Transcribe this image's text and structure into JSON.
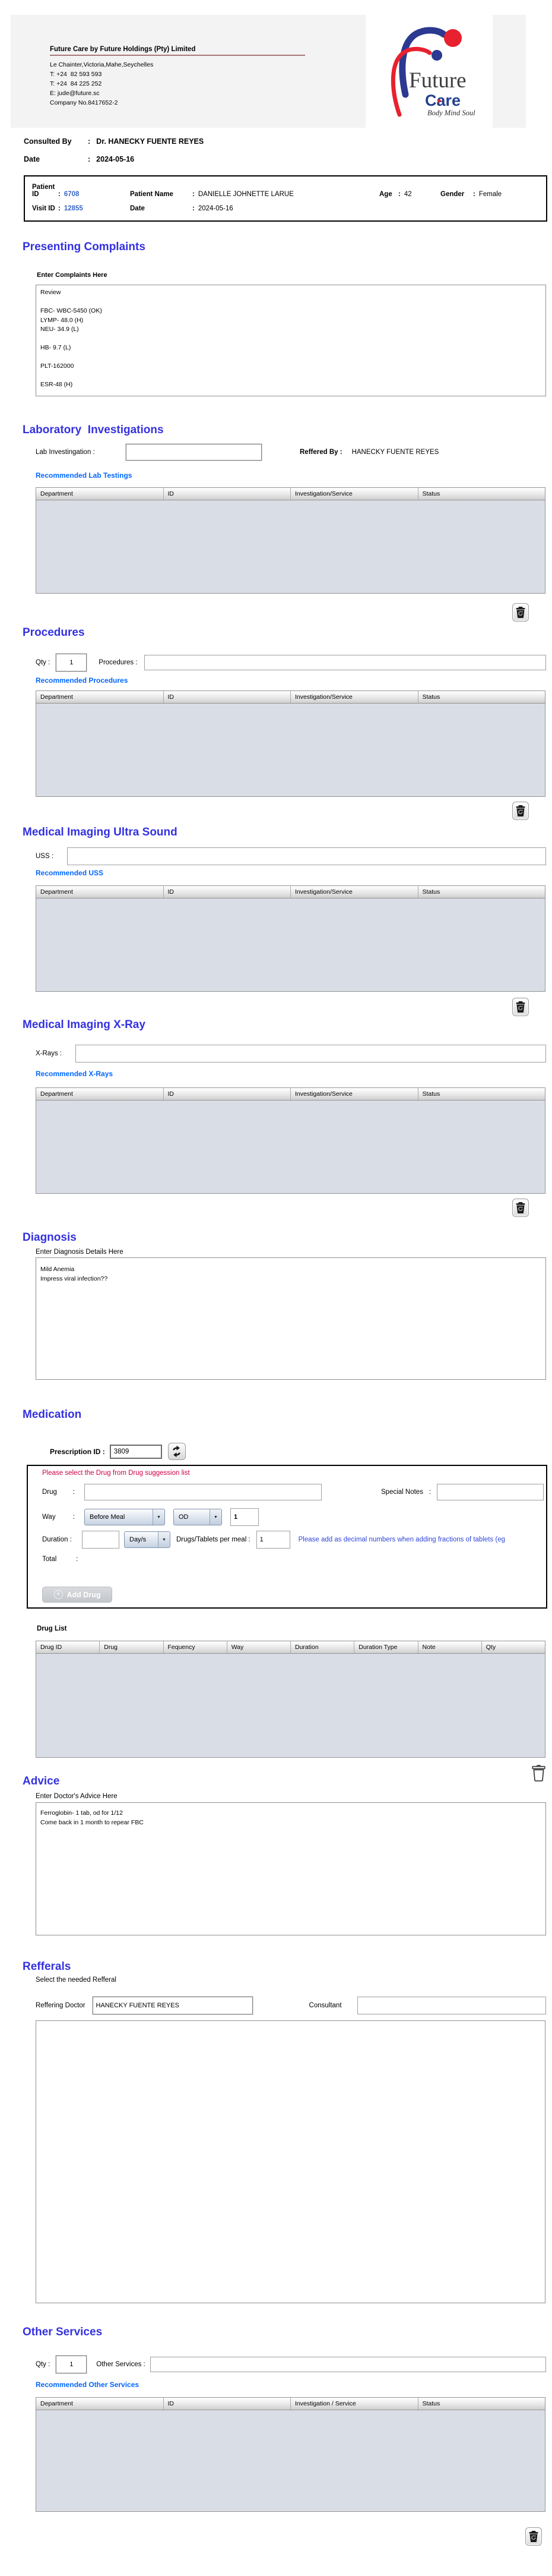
{
  "punct": {
    "colon": ":"
  },
  "colors": {
    "heading_blue": "#3431e0",
    "link_blue": "#0066ff",
    "value_blue": "#3a66c4",
    "warning_red": "#cc0044",
    "note_blue": "#2f46d8",
    "table_body": "#d9dde6"
  },
  "header": {
    "company_name": "Future Care by Future Holdings (Pty) Limited",
    "address": "Le Chainter,Victoria,Mahe,Seychelles",
    "phone1": "T: +24  82 593 593",
    "phone2": "T: +24  84 225 252",
    "email": "E: jude@future.sc",
    "company_no": "Company No.8417652-2",
    "logo": {
      "word1": "Future",
      "word2": "Care",
      "tagline": "Body Mind Soul"
    }
  },
  "consult": {
    "label": "Consulted By",
    "value": "Dr.  HANECKY FUENTE REYES",
    "date_label": "Date",
    "date_value": "2024-05-16"
  },
  "patient_bar": {
    "patient_id_label": "Patient ID",
    "patient_id": "6708",
    "patient_name_label": "Patient Name",
    "patient_name": "DANIELLE JOHNETTE LARUE",
    "age_label": "Age",
    "age": "42",
    "gender_label": "Gender",
    "gender": "Female",
    "visit_id_label": "Visit ID",
    "visit_id": "12855",
    "date_label": "Date",
    "date": "2024-05-16"
  },
  "complaints": {
    "heading": "Presenting Complaints",
    "sublabel": "Enter Complaints Here",
    "text": "Review\n\nFBC- WBC-5450 (OK)\nLYMP- 48.0 (H)\nNEU- 34.9 (L)\n\nHB- 9.7 (L)\n\nPLT-162000\n\nESR-48 (H)"
  },
  "tables": {
    "inv_headers": [
      "Department",
      "ID",
      "Investigation/Service",
      "Status"
    ],
    "other_headers": [
      "Department",
      "ID",
      "Investigation / Service",
      "Status"
    ],
    "drug_headers": [
      "Drug ID",
      "Drug",
      "Fequency",
      "Way",
      "Duration",
      "Duration Type",
      "Note",
      "Qty"
    ]
  },
  "lab": {
    "heading": "Laboratory  Investigations",
    "field_label": "Lab Investingation :",
    "field_value": "",
    "reffered_label": "Reffered By :",
    "reffered_value": "HANECKY FUENTE REYES",
    "link": "Recommended Lab Testings"
  },
  "procedures": {
    "heading": "Procedures",
    "qty_label": "Qty :",
    "qty_value": "1",
    "field_label": "Procedures :",
    "field_value": "",
    "link": "Recommended Procedures"
  },
  "uss": {
    "heading": "Medical Imaging Ultra Sound",
    "field_label": "USS :",
    "field_value": "",
    "link": "Recommended USS"
  },
  "xray": {
    "heading": "Medical Imaging X-Ray",
    "field_label": "X-Rays :",
    "field_value": "",
    "link": "Recommended X-Rays"
  },
  "diagnosis": {
    "heading": "Diagnosis",
    "sublabel": "Enter Diagnosis Details Here",
    "text": "Mild Anemia\nImpress viral infection??"
  },
  "medication": {
    "heading": "Medication",
    "prescription_label": "Prescription ID :",
    "prescription_id": "3809",
    "warning": "Please select the Drug from Drug suggession list",
    "drug_label": "Drug",
    "drug_value": "",
    "special_notes_label": "Special Notes",
    "special_notes_value": "",
    "way_label": "Way",
    "way_option": "Before Meal",
    "frequency_option": "OD",
    "frequency_qty": "1",
    "duration_label": "Duration :",
    "duration_value": "",
    "duration_unit": "Day/s",
    "per_meal_label": "Drugs/Tablets per meal :",
    "per_meal_value": "1",
    "note": "Please add as decimal numbers when adding fractions of tablets (eg",
    "total_label": "Total",
    "add_drug_label": "Add Drug",
    "drug_list_label": "Drug List"
  },
  "advice": {
    "heading": "Advice",
    "sublabel": "Enter Doctor's Advice Here",
    "text": "Ferroglobin- 1 tab, od for 1/12\nCome back in 1 month to repear FBC"
  },
  "refferals": {
    "heading": "Refferals",
    "sublabel": "Select the needed Refferal",
    "doctor_label": "Reffering Doctor",
    "doctor_value": "HANECKY FUENTE REYES",
    "consultant_label": "Consultant",
    "consultant_value": ""
  },
  "other_services": {
    "heading": "Other Services",
    "qty_label": "Qty :",
    "qty_value": "1",
    "field_label": "Other Services :",
    "field_value": "",
    "link": "Recommended Other Services"
  }
}
